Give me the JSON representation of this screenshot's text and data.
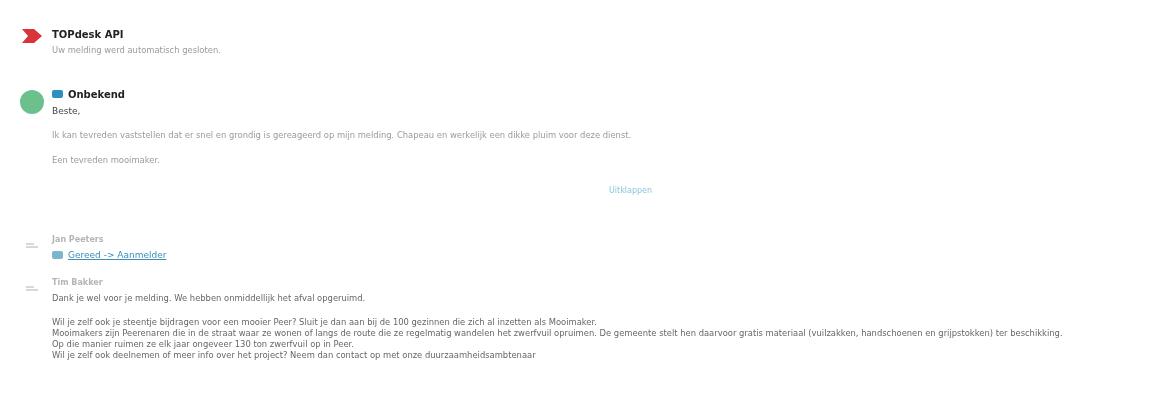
{
  "feed": [
    {
      "kind": "system",
      "author": "TOPdesk API",
      "paragraphs": [
        "Uw melding werd automatisch gesloten."
      ]
    },
    {
      "kind": "customer",
      "author": "Onbekend",
      "greeting": "Beste,",
      "paragraphs": [
        "Ik kan tevreden vaststellen dat er snel en grondig is gereageerd op mijn melding. Chapeau en werkelijk een dikke pluim voor deze dienst.",
        "Een tevreden mooimaker."
      ],
      "expand": "Uitklappen"
    },
    {
      "kind": "status",
      "author": "Jan Peeters",
      "link": "Gereed -> Aanmelder"
    },
    {
      "kind": "operator",
      "author": "Tim Bakker",
      "paragraphs": [
        "Dank je wel voor je melding. We hebben onmiddellijk het afval opgeruimd.",
        "Wil je zelf ook je steentje bijdragen voor een mooier Peer? Sluit je dan aan bij de 100 gezinnen die zich al inzetten als Mooimaker.\nMooimakers zijn Peerenaren die in de straat waar ze wonen of langs de route die ze regelmatig wandelen het zwerfvuil opruimen. De gemeente stelt hen daarvoor gratis materiaal (vuilzakken, handschoenen en grijpstokken) ter beschikking.\nOp die manier ruimen ze elk jaar ongeveer 130 ton zwerfvuil op in Peer.\nWil je zelf ook deelnemen of meer info over het project? Neem dan contact op met onze duurzaamheidsambtenaar"
      ]
    }
  ]
}
